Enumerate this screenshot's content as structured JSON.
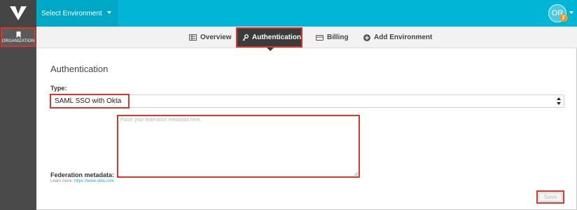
{
  "header": {
    "environment_label": "Select Environment",
    "avatar_initials": "OR",
    "colors": {
      "bar": "#00b5d6",
      "logo_bg": "#454545",
      "highlight": "#d9362b"
    }
  },
  "sidebar": {
    "items": [
      {
        "label": "ORGANIZATION",
        "icon": "bookmark-icon",
        "active": true
      }
    ]
  },
  "tabs": [
    {
      "label": "Overview",
      "icon": "list-icon",
      "active": false
    },
    {
      "label": "Authentication",
      "icon": "key-icon",
      "active": true
    },
    {
      "label": "Billing",
      "icon": "card-icon",
      "active": false
    },
    {
      "label": "Add Environment",
      "icon": "plus-circle-icon",
      "active": false
    }
  ],
  "auth": {
    "heading": "Authentication",
    "type_label": "Type:",
    "type_value": "SAML SSO with Okta",
    "metadata_placeholder": "Paste your federation metadata here.",
    "metadata_value": "",
    "metadata_label": "Federation metadata:",
    "learn_more_text": "Learn more:",
    "learn_more_link": "https://www.okta.com",
    "save_label": "Save"
  }
}
